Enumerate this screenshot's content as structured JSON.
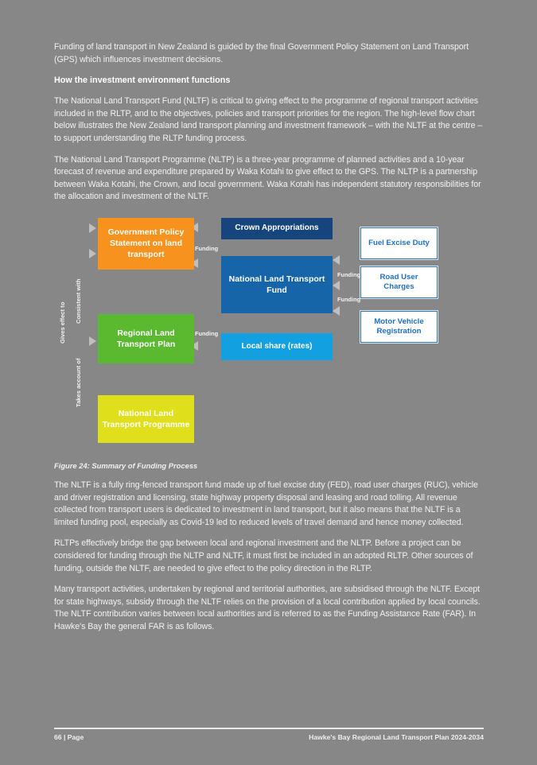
{
  "page": {
    "paragraph_intro": "Funding of land transport in New Zealand is guided by the final Government Policy Statement on Land Transport (GPS) which influences investment decisions.",
    "heading": "How the investment environment functions",
    "paragraph_2": "The National Land Transport Fund (NLTF) is critical to giving effect to the programme of regional transport activities included in the RLTP, and to the objectives, policies and transport priorities for the region.  The high-level flow chart below illustrates the New Zealand land transport planning and investment framework – with the NLTF at the centre – to support understanding the RLTP funding process.",
    "paragraph_3": "The National Land Transport Programme (NLTP) is a three-year programme of planned activities and a 10-year forecast of revenue and expenditure prepared by Waka Kotahi to give effect to the GPS. The NLTP is a partnership between Waka Kotahi, the Crown, and local government.  Waka Kotahi has independent statutory responsibilities for the allocation and investment of the NLTF.",
    "figure_caption": "Figure 24: Summary of Funding Process",
    "paragraph_4": "The NLTF is a fully ring-fenced transport fund made up of fuel excise duty (FED), road user charges (RUC), vehicle and driver registration and licensing, state highway property disposal and leasing and road tolling. All revenue collected from transport users is dedicated to investment in land transport, but it also means that the NLTF is a limited funding pool, especially as Covid-19 led to reduced levels of travel demand and hence money collected.",
    "paragraph_5": "RLTPs effectively bridge the gap between local and regional investment and the NLTP.  Before a project can be considered for funding through the NLTP and NLTF, it must first be included in an adopted RLTP. Other sources of funding, outside the NLTF, are needed to give effect to the policy direction in the RLTP.",
    "paragraph_6": "Many transport activities, undertaken by regional and territorial authorities, are subsidised through the NLTF. Except for state highways, subsidy through the NLTF relies on the provision of a local contribution applied by local councils. The NLTF contribution varies between local authorities and is referred to as the Funding Assistance Rate (FAR). In Hawke's Bay the general FAR is as follows."
  },
  "diagram": {
    "boxes": {
      "gps": "Government Policy Statement on land transport",
      "rltp": "Regional Land Transport Plan",
      "nltp": "National Land Transport Programme",
      "crown": "Crown Appropriations",
      "nltf": "National Land Transport Fund",
      "local": "Local share (rates)",
      "fed": "Fuel Excise Duty",
      "ruc": "Road User Charges",
      "mvr": "Motor Vehicle Registration"
    },
    "arrow_labels": {
      "funding_gps": "Funding",
      "funding_rltp": "Funding",
      "funding_fed": "Funding",
      "funding_ruc": "Funding"
    },
    "side_labels": {
      "gives_effect": "Gives effect to",
      "consistent_with": "Consistent with",
      "takes_account": "Takes account of"
    },
    "colors": {
      "gps": "#f7921e",
      "rltp": "#5bb930",
      "nltp": "#e0df1c",
      "crown": "#16457e",
      "nltf": "#1565a8",
      "local": "#12a0e0",
      "revenue_border": "#2e75b6",
      "connector": "#bfbfbf"
    }
  },
  "footer": {
    "page_number": "66 | Page",
    "document_title": "Hawke's Bay Regional Land Transport Plan 2024-2034"
  }
}
